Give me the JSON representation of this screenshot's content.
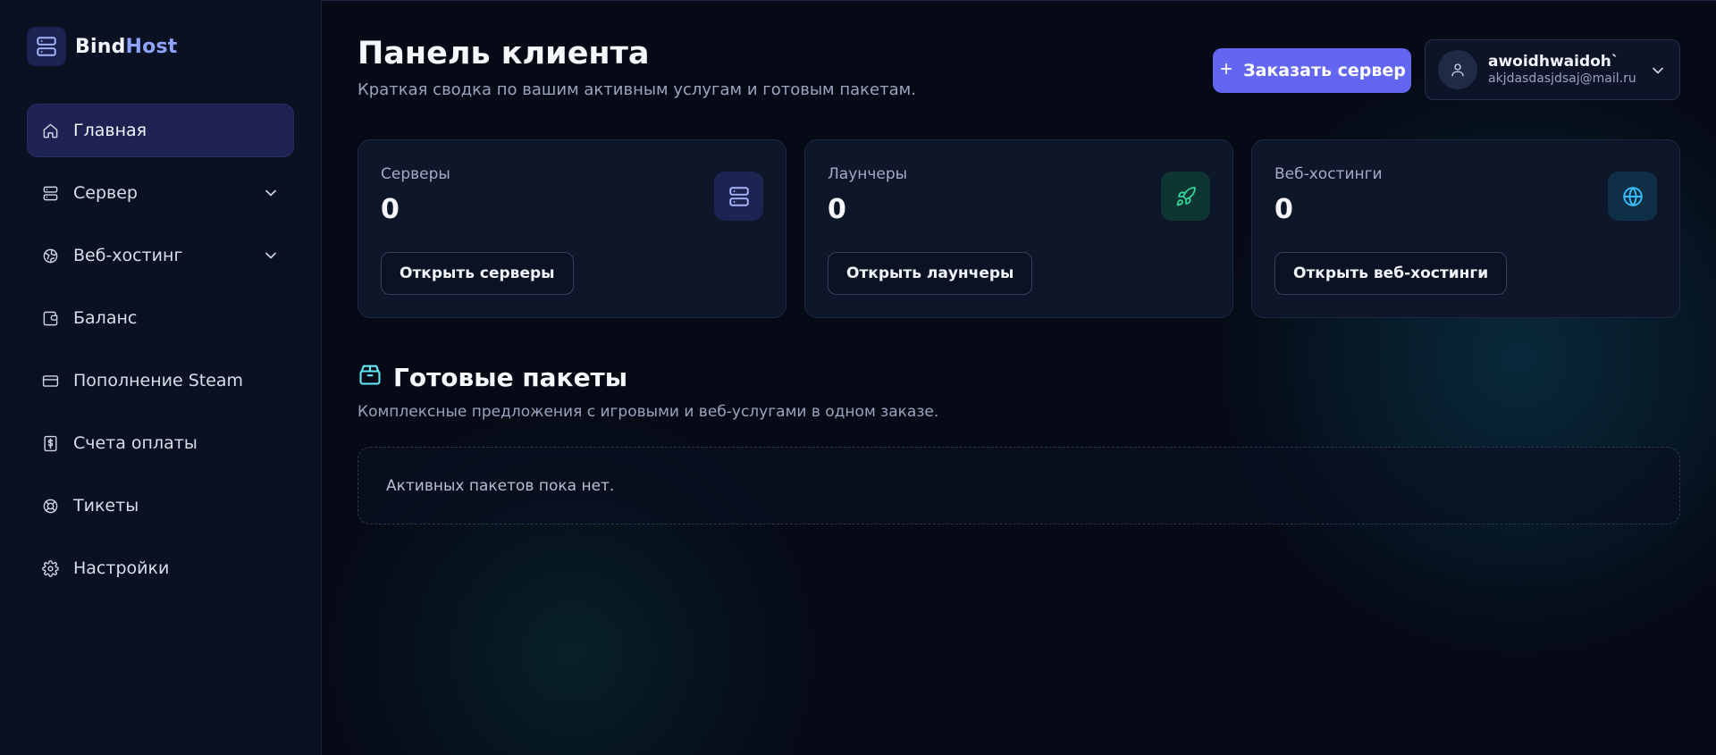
{
  "brand": {
    "name_part1": "Bind",
    "name_part2": "Host"
  },
  "sidebar": {
    "items": [
      {
        "label": "Главная",
        "icon": "home-icon",
        "active": true
      },
      {
        "label": "Сервер",
        "icon": "server-icon",
        "has_submenu": true
      },
      {
        "label": "Веб-хостинг",
        "icon": "globe-icon",
        "has_submenu": true
      },
      {
        "label": "Баланс",
        "icon": "wallet-icon"
      },
      {
        "label": "Пополнение Steam",
        "icon": "credit-card-icon"
      },
      {
        "label": "Счета оплаты",
        "icon": "invoice-icon"
      },
      {
        "label": "Тикеты",
        "icon": "lifebuoy-icon"
      },
      {
        "label": "Настройки",
        "icon": "gear-icon"
      }
    ]
  },
  "header": {
    "title": "Панель клиента",
    "subtitle": "Краткая сводка по вашим активным услугам и готовым пакетам.",
    "order_button": "Заказать сервер"
  },
  "user": {
    "name": "awoidhwaidoh`",
    "email": "akjdasdasjdsaj@mail.ru"
  },
  "cards": [
    {
      "label": "Серверы",
      "value": "0",
      "button": "Открыть серверы",
      "icon": "server-icon",
      "icon_color": "#a5b4fc",
      "icon_bg": "#1e2452"
    },
    {
      "label": "Лаунчеры",
      "value": "0",
      "button": "Открыть лаунчеры",
      "icon": "rocket-icon",
      "icon_color": "#34d399",
      "icon_bg": "#0f3532"
    },
    {
      "label": "Веб-хостинги",
      "value": "0",
      "button": "Открыть веб-хостинги",
      "icon": "globe-icon",
      "icon_color": "#38bdf8",
      "icon_bg": "#0e2f45"
    }
  ],
  "packages": {
    "title": "Готовые пакеты",
    "subtitle": "Комплексные предложения с игровыми и веб-услугами в одном заказе.",
    "empty_text": "Активных пакетов пока нет."
  },
  "colors": {
    "accent": "#6366f1",
    "background": "#060a16",
    "sidebar": "#0a1122"
  }
}
